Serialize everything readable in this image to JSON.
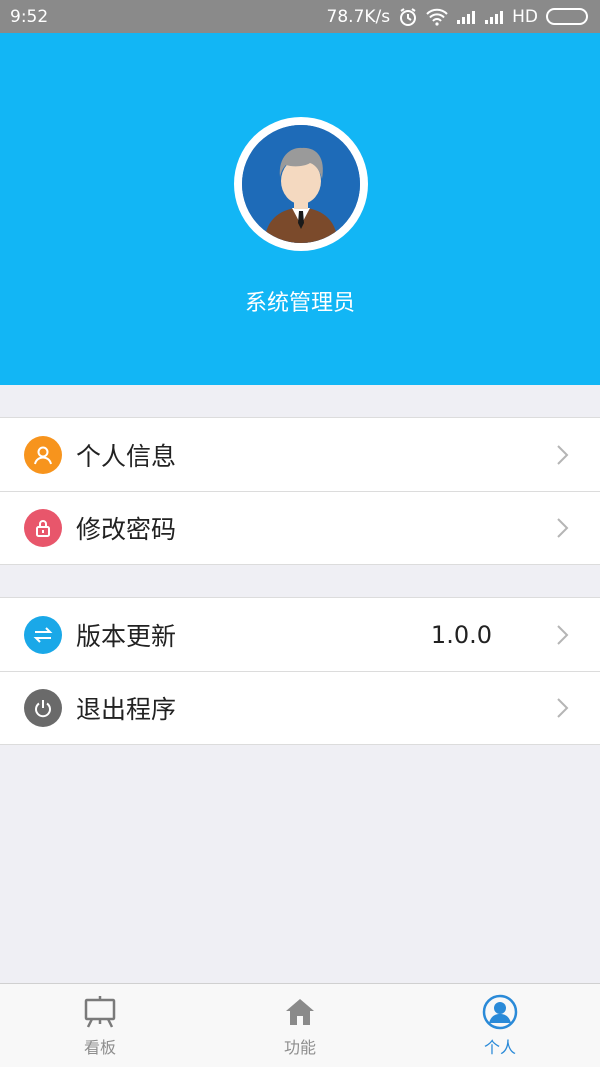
{
  "status_bar": {
    "time": "9:52",
    "speed": "78.7K/s",
    "network_label": "HD",
    "icons": [
      "alarm-icon",
      "wifi-icon",
      "signal-icon",
      "signal-icon",
      "battery-icon"
    ]
  },
  "profile": {
    "name": "系统管理员",
    "avatar_icon": "user-avatar-icon"
  },
  "menu": {
    "group1": [
      {
        "label": "个人信息",
        "icon": "person-icon",
        "color": "#f7941d"
      },
      {
        "label": "修改密码",
        "icon": "lock-icon",
        "color": "#e8566b"
      }
    ],
    "group2": [
      {
        "label": "版本更新",
        "icon": "sync-icon",
        "color": "#1aa8e8",
        "value": "1.0.0"
      },
      {
        "label": "退出程序",
        "icon": "power-icon",
        "color": "#6a6a6a"
      }
    ]
  },
  "tabs": [
    {
      "label": "看板",
      "icon": "board-icon",
      "active": false
    },
    {
      "label": "功能",
      "icon": "home-icon",
      "active": false
    },
    {
      "label": "个人",
      "icon": "person-circle-icon",
      "active": true
    }
  ],
  "colors": {
    "header": "#12b6f5",
    "active_tab": "#2a8ad8"
  }
}
